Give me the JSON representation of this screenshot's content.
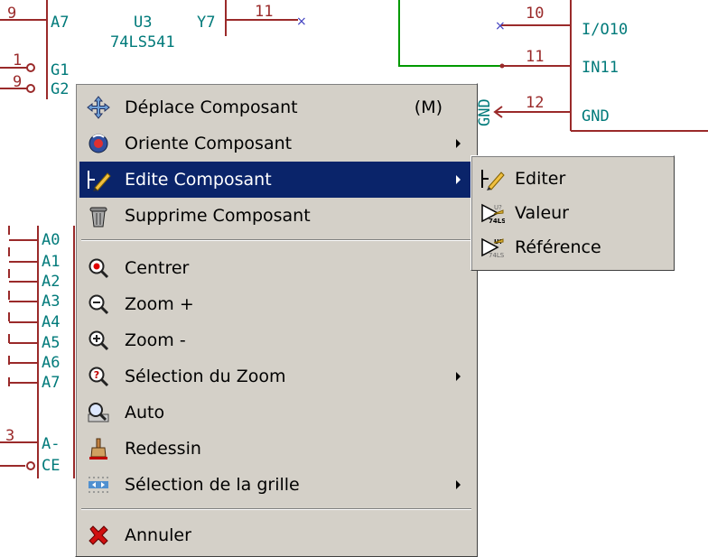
{
  "schematic": {
    "u3_pins_top": [
      "A7",
      "Y7",
      "G1",
      "G2"
    ],
    "u3_ref": "U3",
    "u3_value": "74LS541",
    "pin_numbers_left": [
      "9",
      "1",
      "9"
    ],
    "pin_number_right": "11",
    "right_pins": [
      {
        "number": "10",
        "label": "I/O10"
      },
      {
        "number": "11",
        "label": "IN11"
      },
      {
        "number": "12",
        "label": "GND"
      }
    ],
    "gnd_symbol_label": "GND",
    "lower_chip_pins": [
      "A0",
      "A1",
      "A2",
      "A3",
      "A4",
      "A5",
      "A6",
      "A7",
      "A-",
      "CE"
    ],
    "lower_pin_number": "3"
  },
  "context_menu": {
    "items": [
      {
        "label": "Déplace Composant",
        "shortcut": "(M)",
        "icon": "move-arrows-icon"
      },
      {
        "label": "Oriente Composant",
        "icon": "rotate-icon",
        "submenu": true
      },
      {
        "label": "Edite Composant",
        "icon": "edit-pencil-icon",
        "submenu": true,
        "highlighted": true
      },
      {
        "label": "Supprime Composant",
        "icon": "trash-can-icon"
      },
      {
        "label": "Centrer",
        "icon": "zoom-center-icon"
      },
      {
        "label": "Zoom +",
        "icon": "zoom-in-icon"
      },
      {
        "label": "Zoom -",
        "icon": "zoom-out-icon"
      },
      {
        "label": "Sélection du Zoom",
        "icon": "zoom-select-icon",
        "submenu": true
      },
      {
        "label": "Auto",
        "icon": "zoom-auto-icon"
      },
      {
        "label": "Redessin",
        "icon": "redraw-brush-icon"
      },
      {
        "label": "Sélection de la grille",
        "icon": "grid-icon",
        "submenu": true
      },
      {
        "label": "Annuler",
        "icon": "cancel-x-icon"
      }
    ]
  },
  "submenu": {
    "items": [
      {
        "label": "Editer",
        "icon": "edit-pencil-icon"
      },
      {
        "label": "Valeur",
        "icon": "value-field-icon"
      },
      {
        "label": "Référence",
        "icon": "reference-field-icon"
      }
    ]
  },
  "colors": {
    "wire": "#9a2a2a",
    "green_wire": "#009900",
    "pin_text": "#007a7a",
    "highlight": "#0a246a",
    "menu_bg": "#d4d0c8"
  }
}
